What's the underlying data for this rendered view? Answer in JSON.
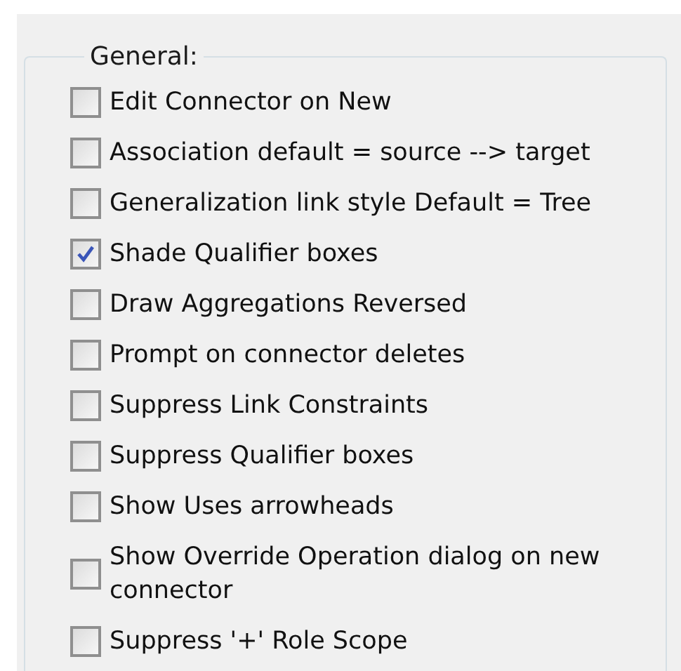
{
  "group": {
    "title": "General:"
  },
  "options": [
    {
      "label": "Edit Connector on New",
      "checked": false
    },
    {
      "label": "Association default = source --> target",
      "checked": false
    },
    {
      "label": "Generalization link style Default = Tree",
      "checked": false
    },
    {
      "label": "Shade Qualifier boxes",
      "checked": true
    },
    {
      "label": "Draw Aggregations Reversed",
      "checked": false
    },
    {
      "label": "Prompt on connector deletes",
      "checked": false
    },
    {
      "label": "Suppress Link Constraints",
      "checked": false
    },
    {
      "label": "Suppress Qualifier boxes",
      "checked": false
    },
    {
      "label": "Show Uses arrowheads",
      "checked": false
    },
    {
      "label": "Show Override Operation dialog on new connector",
      "checked": false
    },
    {
      "label": "Suppress '+' Role Scope",
      "checked": false
    }
  ]
}
